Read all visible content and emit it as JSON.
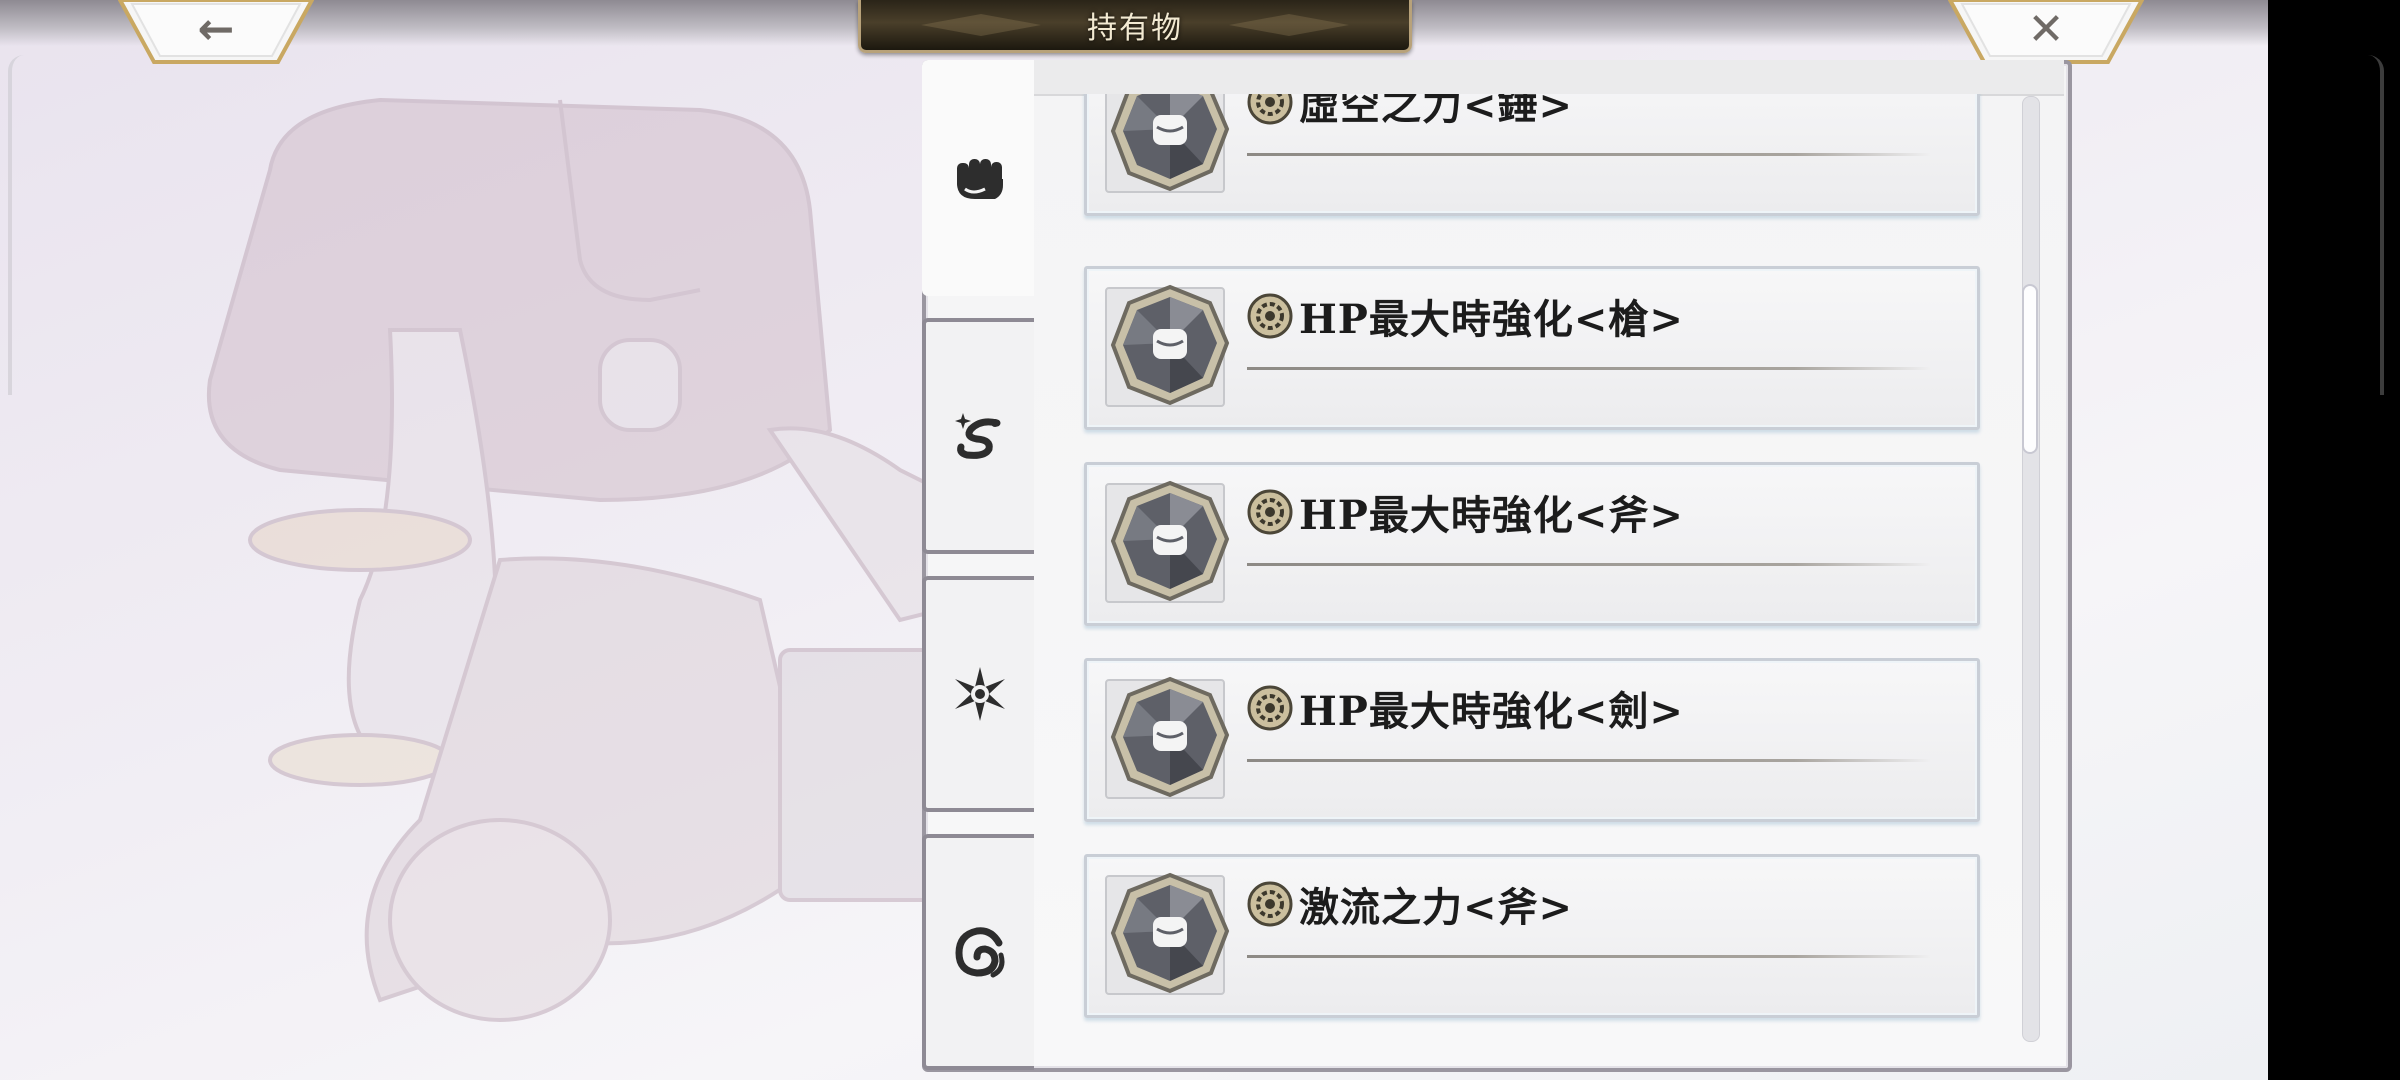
{
  "header": {
    "title": "持有物",
    "back_icon": "back-arrow-icon",
    "close_icon": "close-x-icon",
    "back_glyph": "←",
    "close_glyph": "✕"
  },
  "tabs": [
    {
      "icon": "fist-icon",
      "selected": true
    },
    {
      "icon": "serpent-sparkle-icon",
      "selected": false
    },
    {
      "icon": "compass-star-icon",
      "selected": false
    },
    {
      "icon": "swirl-icon",
      "selected": false
    }
  ],
  "items": [
    {
      "name": "虛空之力<錘>",
      "badge_icon": "fist-octagon-badge-icon",
      "type_icon": "gear-wheel-icon"
    },
    {
      "name": "HP最大時強化<槍>",
      "badge_icon": "fist-octagon-badge-icon",
      "type_icon": "gear-wheel-icon"
    },
    {
      "name": "HP最大時強化<斧>",
      "badge_icon": "fist-octagon-badge-icon",
      "type_icon": "gear-wheel-icon"
    },
    {
      "name": "HP最大時強化<劍>",
      "badge_icon": "fist-octagon-badge-icon",
      "type_icon": "gear-wheel-icon"
    },
    {
      "name": "激流之力<斧>",
      "badge_icon": "fist-octagon-badge-icon",
      "type_icon": "gear-wheel-icon"
    }
  ],
  "colors": {
    "title_plate": "#2a2418",
    "title_text": "#f3ead2",
    "gold_border": "#c9a862",
    "item_border": "#c9ced6"
  }
}
